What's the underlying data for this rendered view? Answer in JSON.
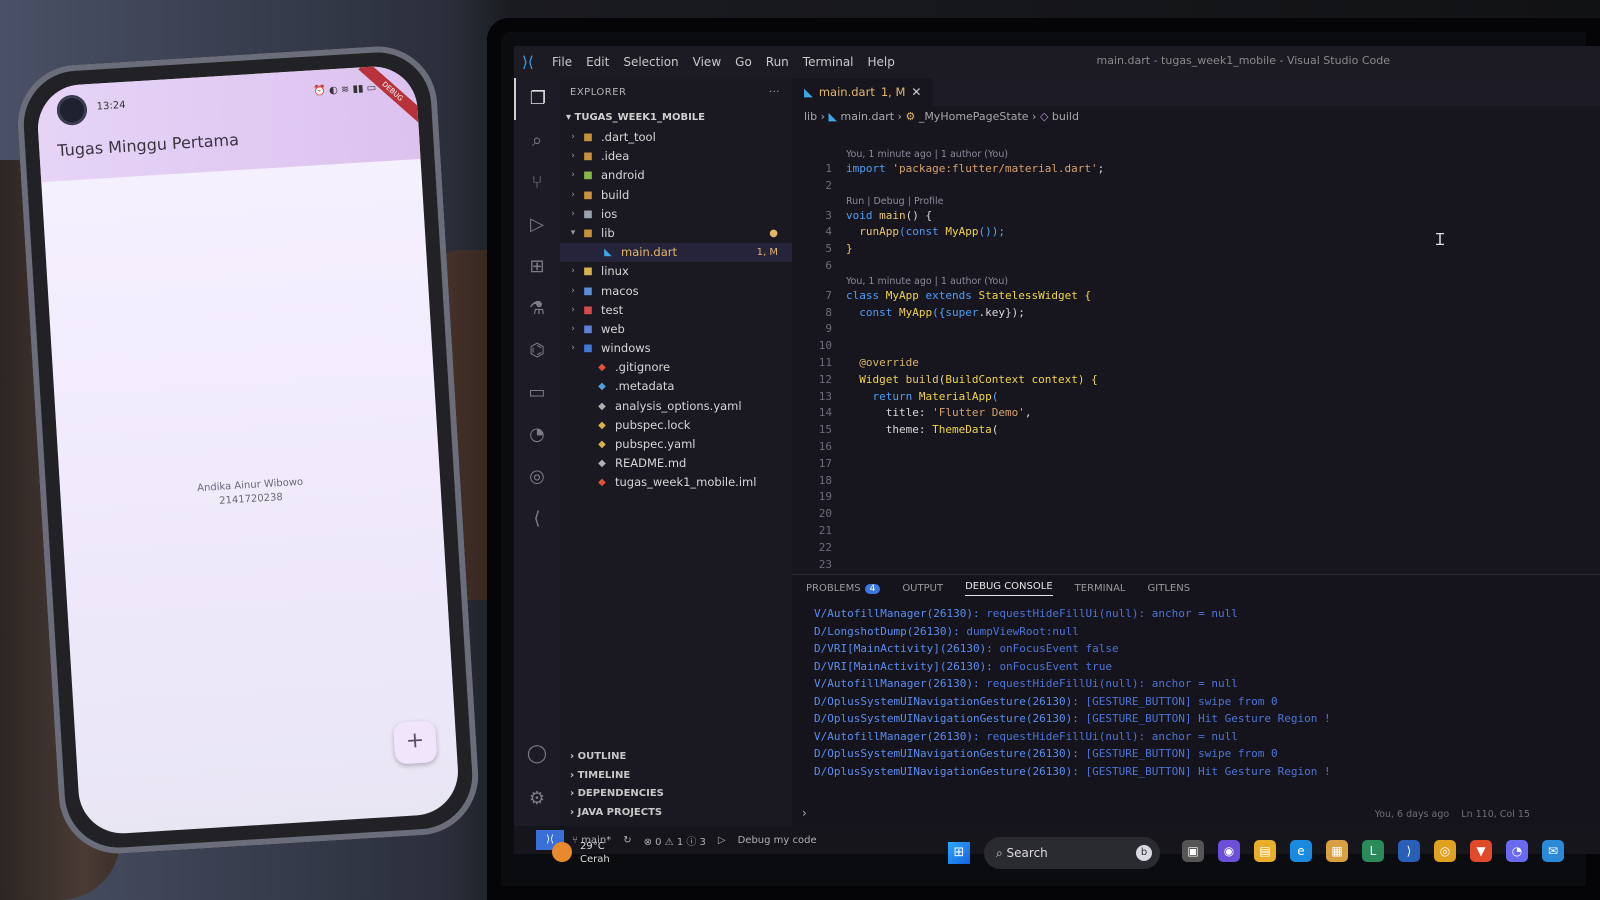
{
  "vscode": {
    "window_title": "main.dart - tugas_week1_mobile - Visual Studio Code",
    "menu": [
      "File",
      "Edit",
      "Selection",
      "View",
      "Go",
      "Run",
      "Terminal",
      "Help"
    ],
    "explorer": {
      "title": "EXPLORER",
      "project": "TUGAS_WEEK1_MOBILE",
      "tree": [
        {
          "label": ".dart_tool",
          "type": "folder",
          "color": "#c8923a"
        },
        {
          "label": ".idea",
          "type": "folder",
          "color": "#c8923a"
        },
        {
          "label": "android",
          "type": "folder",
          "color": "#86b84a"
        },
        {
          "label": "build",
          "type": "folder",
          "color": "#c8923a"
        },
        {
          "label": "ios",
          "type": "folder",
          "color": "#9aa3b0"
        },
        {
          "label": "lib",
          "type": "folder-open",
          "color": "#c8923a",
          "badge": "●"
        },
        {
          "label": "main.dart",
          "type": "file-dart",
          "color": "#3fa7e6",
          "badge": "1, M",
          "selected": true
        },
        {
          "label": "linux",
          "type": "folder",
          "color": "#d8b34a"
        },
        {
          "label": "macos",
          "type": "folder",
          "color": "#5b8cd6"
        },
        {
          "label": "test",
          "type": "folder",
          "color": "#d84a4a"
        },
        {
          "label": "web",
          "type": "folder",
          "color": "#5b7fd6"
        },
        {
          "label": "windows",
          "type": "folder",
          "color": "#3f7ad6"
        },
        {
          "label": ".gitignore",
          "type": "file",
          "color": "#e0523a"
        },
        {
          "label": ".metadata",
          "type": "file",
          "color": "#4aa3e0"
        },
        {
          "label": "analysis_options.yaml",
          "type": "file",
          "color": "#b0b0b0"
        },
        {
          "label": "pubspec.lock",
          "type": "file",
          "color": "#d8b34a"
        },
        {
          "label": "pubspec.yaml",
          "type": "file",
          "color": "#d8b34a"
        },
        {
          "label": "README.md",
          "type": "file",
          "color": "#b0b0b0"
        },
        {
          "label": "tugas_week1_mobile.iml",
          "type": "file",
          "color": "#e0523a"
        }
      ],
      "sections": [
        "OUTLINE",
        "TIMELINE",
        "DEPENDENCIES",
        "JAVA PROJECTS"
      ]
    },
    "tab": {
      "label": "main.dart",
      "badge": "1, M"
    },
    "breadcrumb": [
      "lib",
      "main.dart",
      "_MyHomePageState",
      "build"
    ],
    "code_lens": {
      "blame1": "You, 1 minute ago | 1 author (You)",
      "run": "Run | Debug | Profile",
      "blame2": "You, 1 minute ago | 1 author (You)"
    },
    "line_numbers": [
      "1",
      "2",
      "3",
      "4",
      "5",
      "6",
      "7",
      "8",
      "9",
      "10",
      "11",
      "12",
      "13",
      "14",
      "15",
      "16",
      "17",
      "18",
      "19",
      "20",
      "21",
      "22",
      "23"
    ],
    "code": {
      "l1_kw": "import",
      "l1_str": " 'package:flutter/material.dart'",
      "l1_end": ";",
      "l3_kw": "void",
      "l3_fn": " main",
      "l3_end": "() {",
      "l4_fn": "  runApp",
      "l4_a": "(const ",
      "l4_cls": "MyApp",
      "l4_end": "());",
      "l5": "}",
      "l7_kw": "class",
      "l7_cls": " MyApp",
      "l7_kw2": " extends",
      "l7_cls2": " StatelessWidget",
      "l7_end": " {",
      "l8_kw": "  const",
      "l8_cls": " MyApp",
      "l8_a": "({",
      "l8_kw2": "super",
      "l8_end": ".key});",
      "l11": "  @override",
      "l12_cls": "  Widget",
      "l12_fn": " build",
      "l12_a": "(",
      "l12_cls2": "BuildContext",
      "l12_end": " context) {",
      "l13_kw": "    return",
      "l13_cls": " MaterialApp",
      "l13_end": "(",
      "l14_a": "      title: ",
      "l14_str": "'Flutter Demo'",
      "l14_end": ",",
      "l15_a": "      theme: ",
      "l15_cls": "ThemeData",
      "l15_end": "("
    },
    "panel": {
      "tabs": [
        "PROBLEMS",
        "OUTPUT",
        "DEBUG CONSOLE",
        "TERMINAL",
        "GITLENS"
      ],
      "problems_count": "4",
      "active_tab": "DEBUG CONSOLE",
      "lines": [
        {
          "src": "V/AutofillManager(26130): ",
          "msg": "requestHideFillUi(null): anchor = null"
        },
        {
          "src": "D/LongshotDump(26130): ",
          "msg": "dumpViewRoot:null"
        },
        {
          "src": "D/VRI[MainActivity](26130): ",
          "msg": "onFocusEvent false"
        },
        {
          "src": "D/VRI[MainActivity](26130): ",
          "msg": "onFocusEvent true"
        },
        {
          "src": "V/AutofillManager(26130): ",
          "msg": "requestHideFillUi(null): anchor = null"
        },
        {
          "src": "D/OplusSystemUINavigationGesture(26130): ",
          "msg": "[GESTURE_BUTTON] swipe from 0"
        },
        {
          "src": "D/OplusSystemUINavigationGesture(26130): ",
          "msg": "[GESTURE_BUTTON] Hit Gesture Region !"
        },
        {
          "src": "V/AutofillManager(26130): ",
          "msg": "requestHideFillUi(null): anchor = null"
        },
        {
          "src": "D/OplusSystemUINavigationGesture(26130): ",
          "msg": "[GESTURE_BUTTON] swipe from 0"
        },
        {
          "src": "D/OplusSystemUINavigationGesture(26130): ",
          "msg": "[GESTURE_BUTTON] Hit Gesture Region !"
        }
      ],
      "blame": "You, 6 days ago",
      "position": "Ln 110, Col 15"
    },
    "status": {
      "branch": "main*",
      "problems": "⊗ 0 ⚠ 1 ⓘ 3",
      "debug": "Debug my code"
    }
  },
  "taskbar": {
    "weather_temp": "29°C",
    "weather_desc": "Cerah",
    "search": "Search"
  },
  "phone": {
    "time": "13:24",
    "app_title": "Tugas Minggu Pertama",
    "name": "Andika Ainur Wibowo",
    "nim": "2141720238",
    "fab": "+",
    "debug_banner": "DEBUG"
  }
}
